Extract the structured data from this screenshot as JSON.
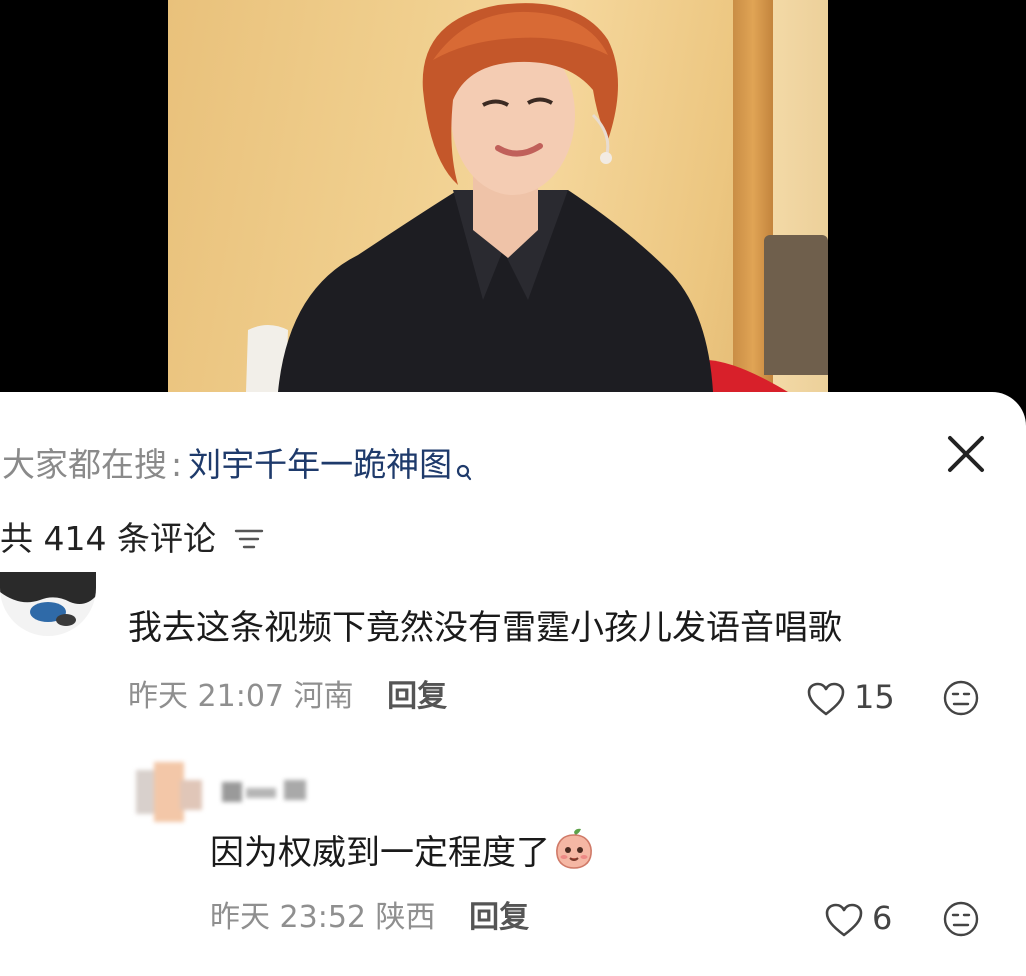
{
  "search": {
    "prefix": "大家都在搜",
    "separator": ":",
    "term": "刘宇千年一跪神图",
    "term_color": "#1e3a6b"
  },
  "comments_header": {
    "count_label": "共 414 条评论",
    "sort_icon": "sort-lines-icon",
    "close_icon": "close-icon"
  },
  "comments": [
    {
      "text": "我去这条视频下竟然没有雷霆小孩儿发语音唱歌",
      "time": "昨天 21:07",
      "location": "河南",
      "reply_label": "回复",
      "likes": "15"
    },
    {
      "text": "因为权威到一定程度了",
      "emoji": "peach-face-emoji",
      "time": "昨天 23:52",
      "location": "陕西",
      "reply_label": "回复",
      "likes": "6"
    }
  ]
}
